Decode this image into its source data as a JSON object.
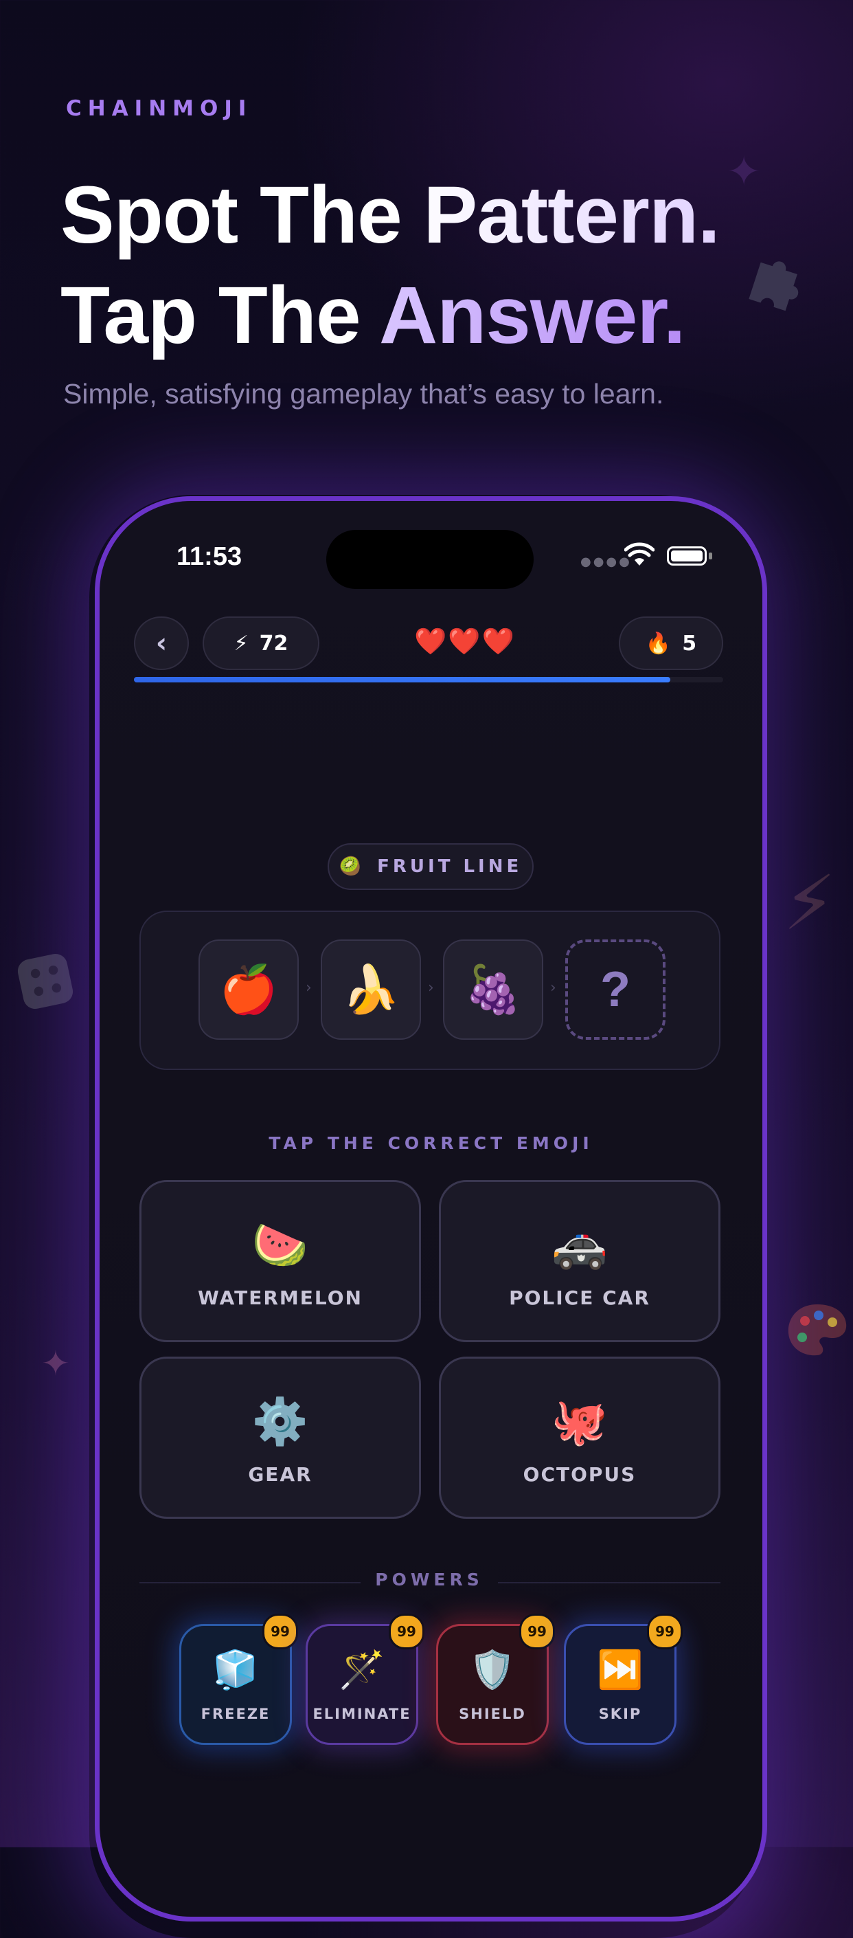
{
  "brand": "CHAINMOJI",
  "headline": {
    "line1": "Spot The Pattern.",
    "line2_a": "Tap The ",
    "line2_b": "Answer."
  },
  "subtitle": "Simple, satisfying gameplay that’s easy to learn.",
  "phone": {
    "status": {
      "time": "11:53"
    },
    "topbar": {
      "back_icon": "‹",
      "energy_icon": "⚡",
      "energy_value": "72",
      "hearts": "❤️❤️❤️",
      "lives": 3,
      "streak_icon": "🔥",
      "streak_value": "5",
      "progress": 0.91
    },
    "category": {
      "icon": "🥝",
      "label": "FRUIT LINE"
    },
    "sequence": [
      "🍎",
      "🍌",
      "🍇",
      "?"
    ],
    "prompt": "TAP THE CORRECT EMOJI",
    "answers": [
      {
        "emoji": "🍉",
        "label": "WATERMELON"
      },
      {
        "emoji": "🚓",
        "label": "POLICE CAR"
      },
      {
        "emoji": "⚙️",
        "label": "GEAR"
      },
      {
        "emoji": "🐙",
        "label": "OCTOPUS"
      }
    ],
    "powers_title": "POWERS",
    "powers": [
      {
        "icon": "🧊",
        "label": "FREEZE",
        "count": "99"
      },
      {
        "icon": "🪄",
        "label": "ELIMINATE",
        "count": "99"
      },
      {
        "icon": "🛡️",
        "label": "SHIELD",
        "count": "99"
      },
      {
        "icon": "⏭️",
        "label": "SKIP",
        "count": "99"
      }
    ]
  },
  "colors": {
    "brand_accent": "#a77cf0",
    "phone_frame": "#6a33c8",
    "progress": "#3a7dff",
    "badge": "#f3a91e"
  },
  "icons": {
    "decorative": [
      "sparkle-icon",
      "puzzle-icon",
      "lightning-icon",
      "dice-icon",
      "palette-icon",
      "star-icon"
    ]
  }
}
